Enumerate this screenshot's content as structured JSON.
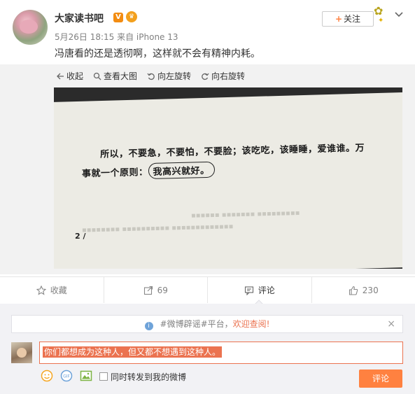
{
  "post": {
    "username": "大家读书吧",
    "verified_badge": "V",
    "member_badge": "♛",
    "meta": "5月26日 18:15 来自 iPhone 13",
    "text": "冯唐看的还是透彻啊，这样就不会有精神内耗。",
    "follow_label": "关注",
    "follow_plus": "+"
  },
  "viewer": {
    "tools": [
      {
        "label": "收起",
        "icon": "collapse-icon"
      },
      {
        "label": "查看大图",
        "icon": "zoom-icon"
      },
      {
        "label": "向左旋转",
        "icon": "rotate-left-icon"
      },
      {
        "label": "向右旋转",
        "icon": "rotate-right-icon"
      }
    ],
    "photo": {
      "line1": "所以，不要急，不要怕，不要脸；该吃吃，该睡睡，爱谁谁。万",
      "line2_prefix": "事就一个原则：",
      "line2_circled": "我高兴就好。",
      "page_number": "2 /"
    }
  },
  "actions": [
    {
      "label": "收藏",
      "icon": "star-icon"
    },
    {
      "label": "69",
      "icon": "repost-icon"
    },
    {
      "label": "评论",
      "icon": "comment-icon"
    },
    {
      "label": "230",
      "icon": "like-icon"
    }
  ],
  "comment": {
    "notice_prefix": "#微博辟谣#平台，",
    "notice_highlight": "欢迎查阅!",
    "notice_close": "×",
    "input_value": "你们都想成为这种人，但又都不想遇到这种人。",
    "repost_label": "同时转发到我的微博",
    "submit_label": "评论"
  },
  "colors": {
    "accent": "#ff8140",
    "highlight": "#eb7350",
    "muted": "#808080"
  }
}
